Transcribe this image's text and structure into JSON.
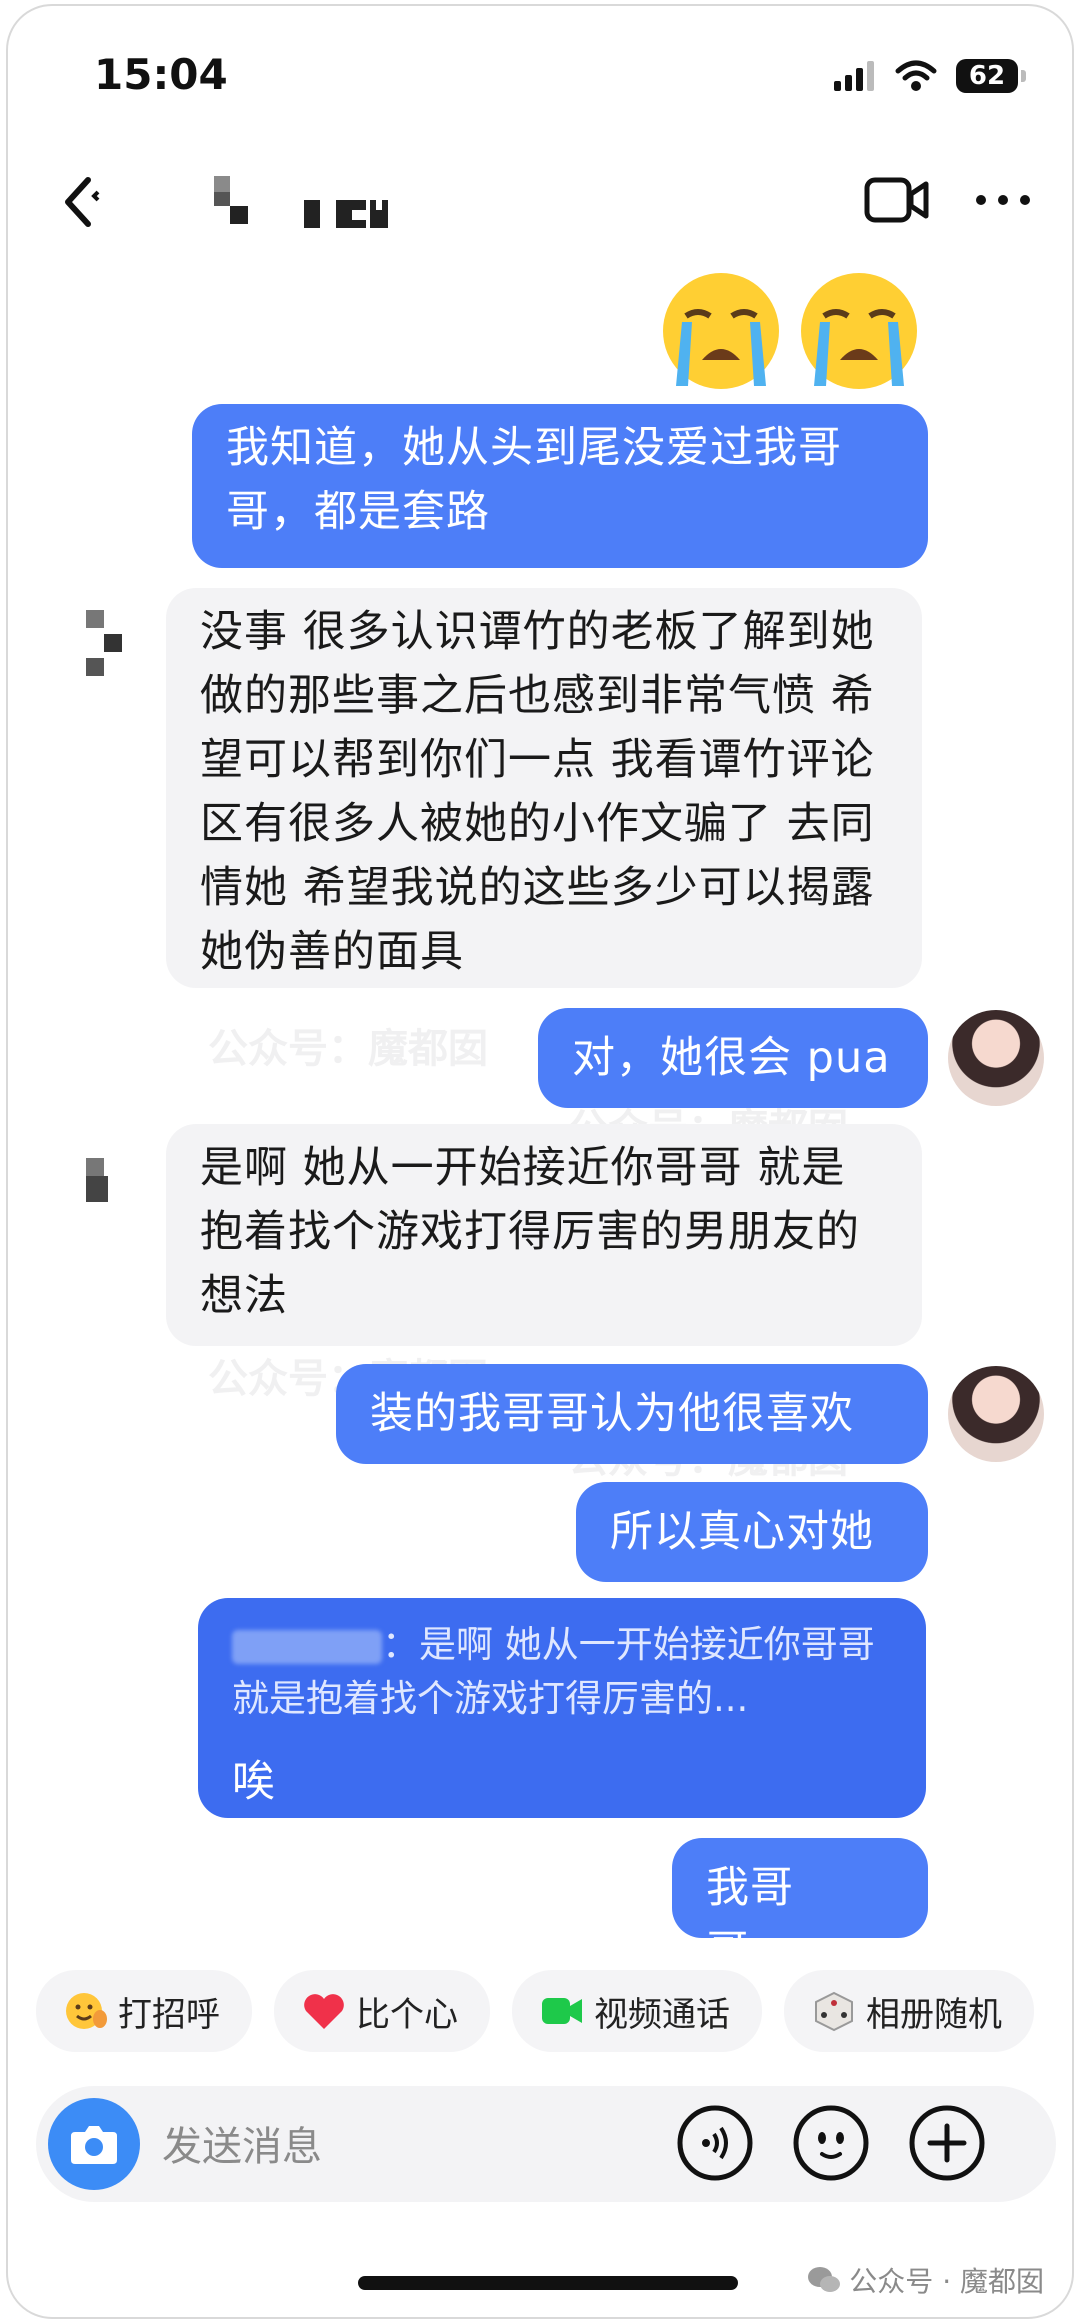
{
  "status": {
    "time": "15:04",
    "battery": "62"
  },
  "header": {
    "contact_name_obscured": true
  },
  "messages": [
    {
      "side": "out",
      "text": "我知道，她从头到尾没爱过我哥哥，都是套路"
    },
    {
      "side": "in",
      "text": "没事 很多认识谭竹的老板了解到她做的那些事之后也感到非常气愤 希望可以帮到你们一点 我看谭竹评论区有很多人被她的小作文骗了 去同情她 希望我说的这些多少可以揭露她伪善的面具"
    },
    {
      "side": "out",
      "text": "对，她很会 pua"
    },
    {
      "side": "in",
      "text": "是啊 她从一开始接近你哥哥 就是抱着找个游戏打得厉害的男朋友的想法"
    },
    {
      "side": "out",
      "text": "装的我哥哥认为他很喜欢"
    },
    {
      "side": "out",
      "text": "所以真心对她"
    },
    {
      "side": "out",
      "quote": "：是啊 她从一开始接近你哥哥 就是抱着找个游戏打得厉害的...",
      "text": "唉"
    },
    {
      "side": "out",
      "text": "我哥哥...."
    }
  ],
  "watermark": {
    "text": "公众号：魔都囡"
  },
  "quick_actions": [
    {
      "label": "打招呼",
      "icon": "wave-emoji-icon"
    },
    {
      "label": "比个心",
      "icon": "heart-icon"
    },
    {
      "label": "视频通话",
      "icon": "video-camera-icon"
    },
    {
      "label": "相册随机",
      "icon": "dice-icon"
    }
  ],
  "input": {
    "placeholder": "发送消息"
  },
  "footer": {
    "text": "公众号 · 魔都囡"
  },
  "colors": {
    "outgoing": "#4d7ef8",
    "incoming": "#f3f3f5",
    "camera": "#3c8cf6"
  }
}
